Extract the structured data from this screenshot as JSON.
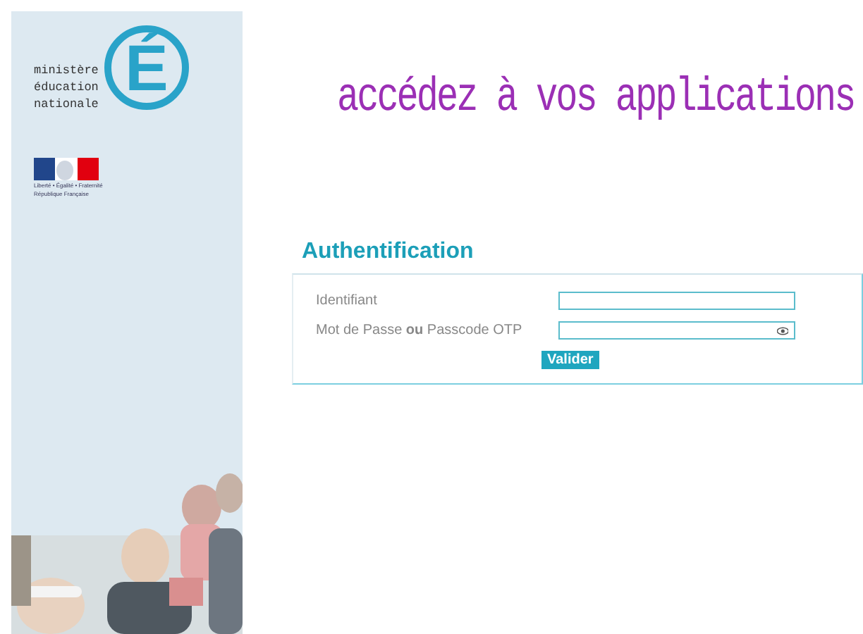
{
  "sidebar": {
    "logo": {
      "lines": [
        "ministère",
        "éducation",
        "nationale"
      ],
      "letter": "É"
    },
    "republic": {
      "motto": "Liberté • Égalité • Fraternité",
      "name": "République Française"
    }
  },
  "headline": "accédez à vos applications",
  "login": {
    "title": "Authentification",
    "fields": [
      {
        "label": "Identifiant",
        "kind": "text"
      },
      {
        "label": "Mot de Passe **ou** Passcode OTP",
        "kind": "password"
      }
    ],
    "submit": "Valider"
  }
}
